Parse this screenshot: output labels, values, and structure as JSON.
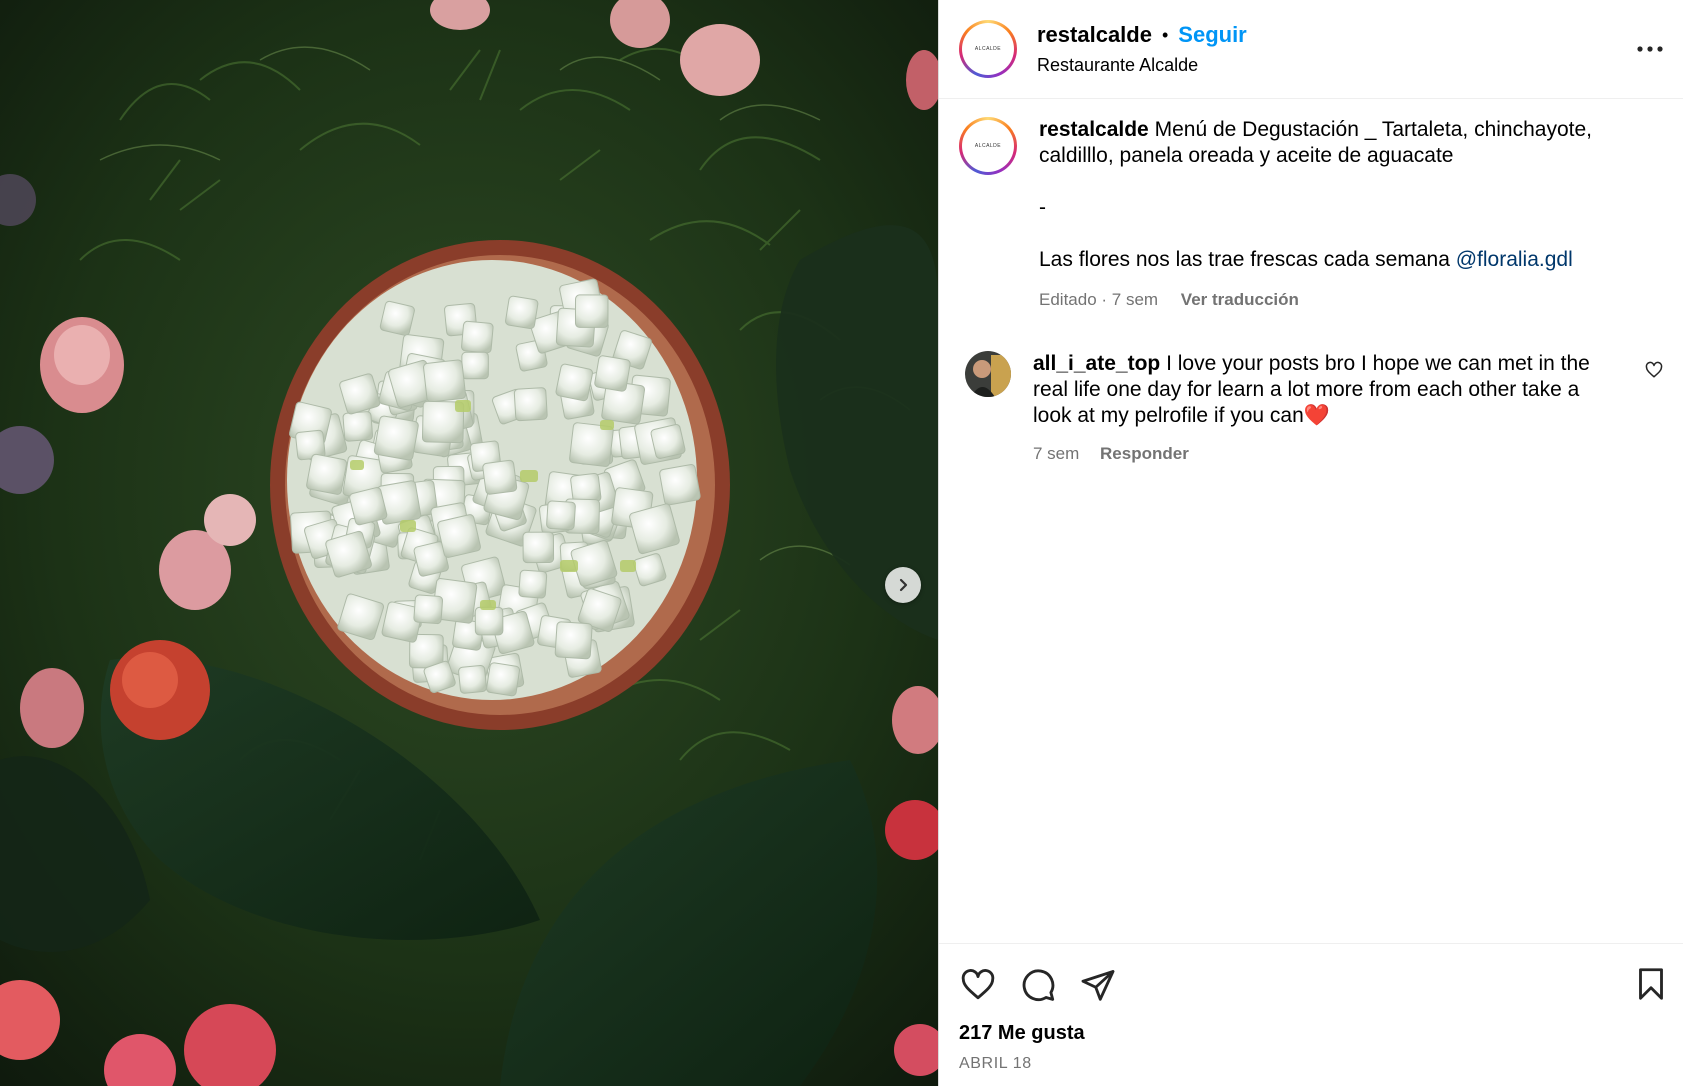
{
  "header": {
    "username": "restalcalde",
    "dot": "•",
    "follow_label": "Seguir",
    "subtitle": "Restaurante Alcalde",
    "avatar_text": "ALCALDE"
  },
  "caption": {
    "username": "restalcalde",
    "text_line": "Menú de Degustación _ Tartaleta, chinchayote, caldilllo, panela oreada y aceite de aguacate",
    "dash": "-",
    "text_2": "Las flores nos las trae frescas cada semana ",
    "mention": "@floralia.gdl",
    "edited": "Editado · 7 sem",
    "translate": "Ver traducción"
  },
  "comment": {
    "username": "all_i_ate_top",
    "text": "I love your posts bro I hope we can met in the real life one day for learn a lot more from each other take a look at my pelrofile if you can❤️",
    "time": "7 sem",
    "reply": "Responder"
  },
  "footer": {
    "likes": "217 Me gusta",
    "date": "ABRIL 18"
  },
  "icons": {
    "next": "chevron-right-icon",
    "more": "more-horizontal-icon",
    "like": "heart-icon",
    "comment": "comment-icon",
    "share": "send-icon",
    "save": "bookmark-icon",
    "comment_like": "heart-icon"
  }
}
